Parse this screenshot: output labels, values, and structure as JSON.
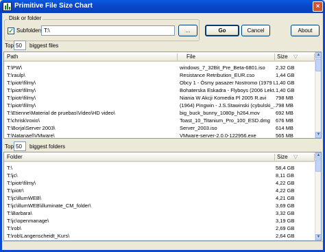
{
  "window": {
    "title": "Primitive File Size Chart",
    "close_symbol": "×"
  },
  "scan": {
    "group_label": "Disk or folder",
    "subfolders_label": "Subfolders",
    "subfolders_checked": true,
    "check_symbol": "✓",
    "path_value": "T:\\",
    "browse_label": "...",
    "go_label": "Go",
    "cancel_label": "Cancel",
    "about_label": "About"
  },
  "files": {
    "top_label": "Top",
    "top_value": "50",
    "suffix": "biggest files",
    "columns": [
      "Path",
      "File",
      "Size"
    ],
    "sort_symbol": "▽",
    "rows": [
      [
        "T:\\PW\\",
        "windows_7_32Bit_Pre_Beta-6801.iso",
        "2,32 GB"
      ],
      [
        "T:\\raulp\\",
        "Resistance Retribution_EUR.cso",
        "1,44 GB"
      ],
      [
        "T:\\piotr\\filmy\\",
        "Obcy 1 - Ósmy pasazer Nostromo (1979 Lek...",
        "1,40 GB"
      ],
      [
        "T:\\piotr\\filmy\\",
        "Bohaterska Eskadra - Flyboys (2006 Lekt...",
        "1,40 GB"
      ],
      [
        "T:\\piotr\\filmy\\",
        "Niania W Akcji Komedia Pl 2005 R.avi",
        "798 MB"
      ],
      [
        "T:\\piotr\\filmy\\",
        "(1964) Pingwin - J.S.Stawinski (cybulski_...",
        "798 MB"
      ],
      [
        "T:\\Etienne\\Material de pruebas\\Video\\HD video\\",
        "big_buck_bunny_1080p_h264.mov",
        "692 MB"
      ],
      [
        "T:\\chrisk\\roxio\\",
        "Toast_10_Titanium_Pro_100_ESD.dmg",
        "676 MB"
      ],
      [
        "T:\\Borja\\Server 2003\\",
        "Server_2003.iso",
        "614 MB"
      ],
      [
        "T:\\Natanael\\VMware\\",
        "VMware-server-2.0.0-122956.exe",
        "565 MB"
      ]
    ]
  },
  "folders": {
    "top_label": "Top",
    "top_value": "50",
    "suffix": "biggest folders",
    "columns": [
      "Folder",
      "Size"
    ],
    "sort_symbol": "▽",
    "rows": [
      [
        "T:\\",
        "58,4 GB"
      ],
      [
        "T:\\jc\\",
        "8,11 GB"
      ],
      [
        "T:\\piotr\\filmy\\",
        "4,22 GB"
      ],
      [
        "T:\\piotr\\",
        "4,22 GB"
      ],
      [
        "T:\\jc\\illumWEB\\",
        "4,21 GB"
      ],
      [
        "T:\\jc\\illumWEB\\illuminate_CM_folder\\",
        "3,69 GB"
      ],
      [
        "T:\\Barbara\\",
        "3,32 GB"
      ],
      [
        "T:\\jc\\openmanage\\",
        "3,19 GB"
      ],
      [
        "T:\\rob\\",
        "2,69 GB"
      ],
      [
        "T:\\rob\\Langenscheidt_Kurs\\",
        "2,64 GB"
      ]
    ]
  },
  "scroll_arrows": {
    "up": "▲",
    "down": "▼"
  }
}
